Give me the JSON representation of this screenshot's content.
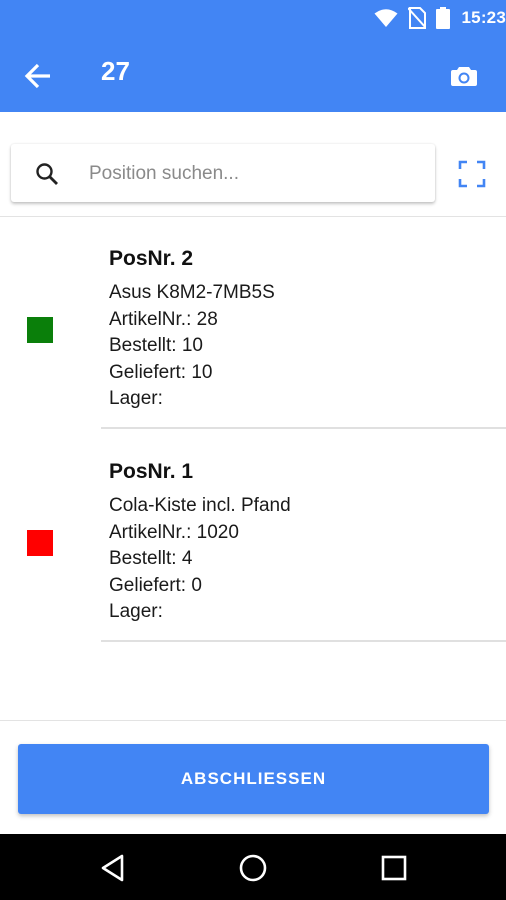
{
  "status_bar": {
    "time": "15:23"
  },
  "toolbar": {
    "title": "27"
  },
  "search": {
    "placeholder": "Position suchen...",
    "value": ""
  },
  "items": [
    {
      "title": "PosNr. 2",
      "name": "Asus K8M2-7MB5S",
      "artikel": "ArtikelNr.: 28",
      "bestellt": "Bestellt: 10",
      "geliefert": "Geliefert: 10",
      "lager": "Lager:",
      "status_color": "#0A7F0A"
    },
    {
      "title": "PosNr. 1",
      "name": "Cola-Kiste incl. Pfand",
      "artikel": "ArtikelNr.: 1020",
      "bestellt": "Bestellt: 4",
      "geliefert": "Geliefert: 0",
      "lager": "Lager:",
      "status_color": "#FF0000"
    }
  ],
  "footer": {
    "finish_label": "ABSCHLIESSEN"
  },
  "colors": {
    "primary": "#4285F4",
    "complete": "#0A7F0A",
    "incomplete": "#FF0000"
  },
  "icons": [
    "wifi-icon",
    "no-sim-icon",
    "battery-icon",
    "back-arrow-icon",
    "camera-icon",
    "search-icon",
    "scan-frame-icon",
    "nav-back-icon",
    "nav-home-icon",
    "nav-recents-icon"
  ]
}
